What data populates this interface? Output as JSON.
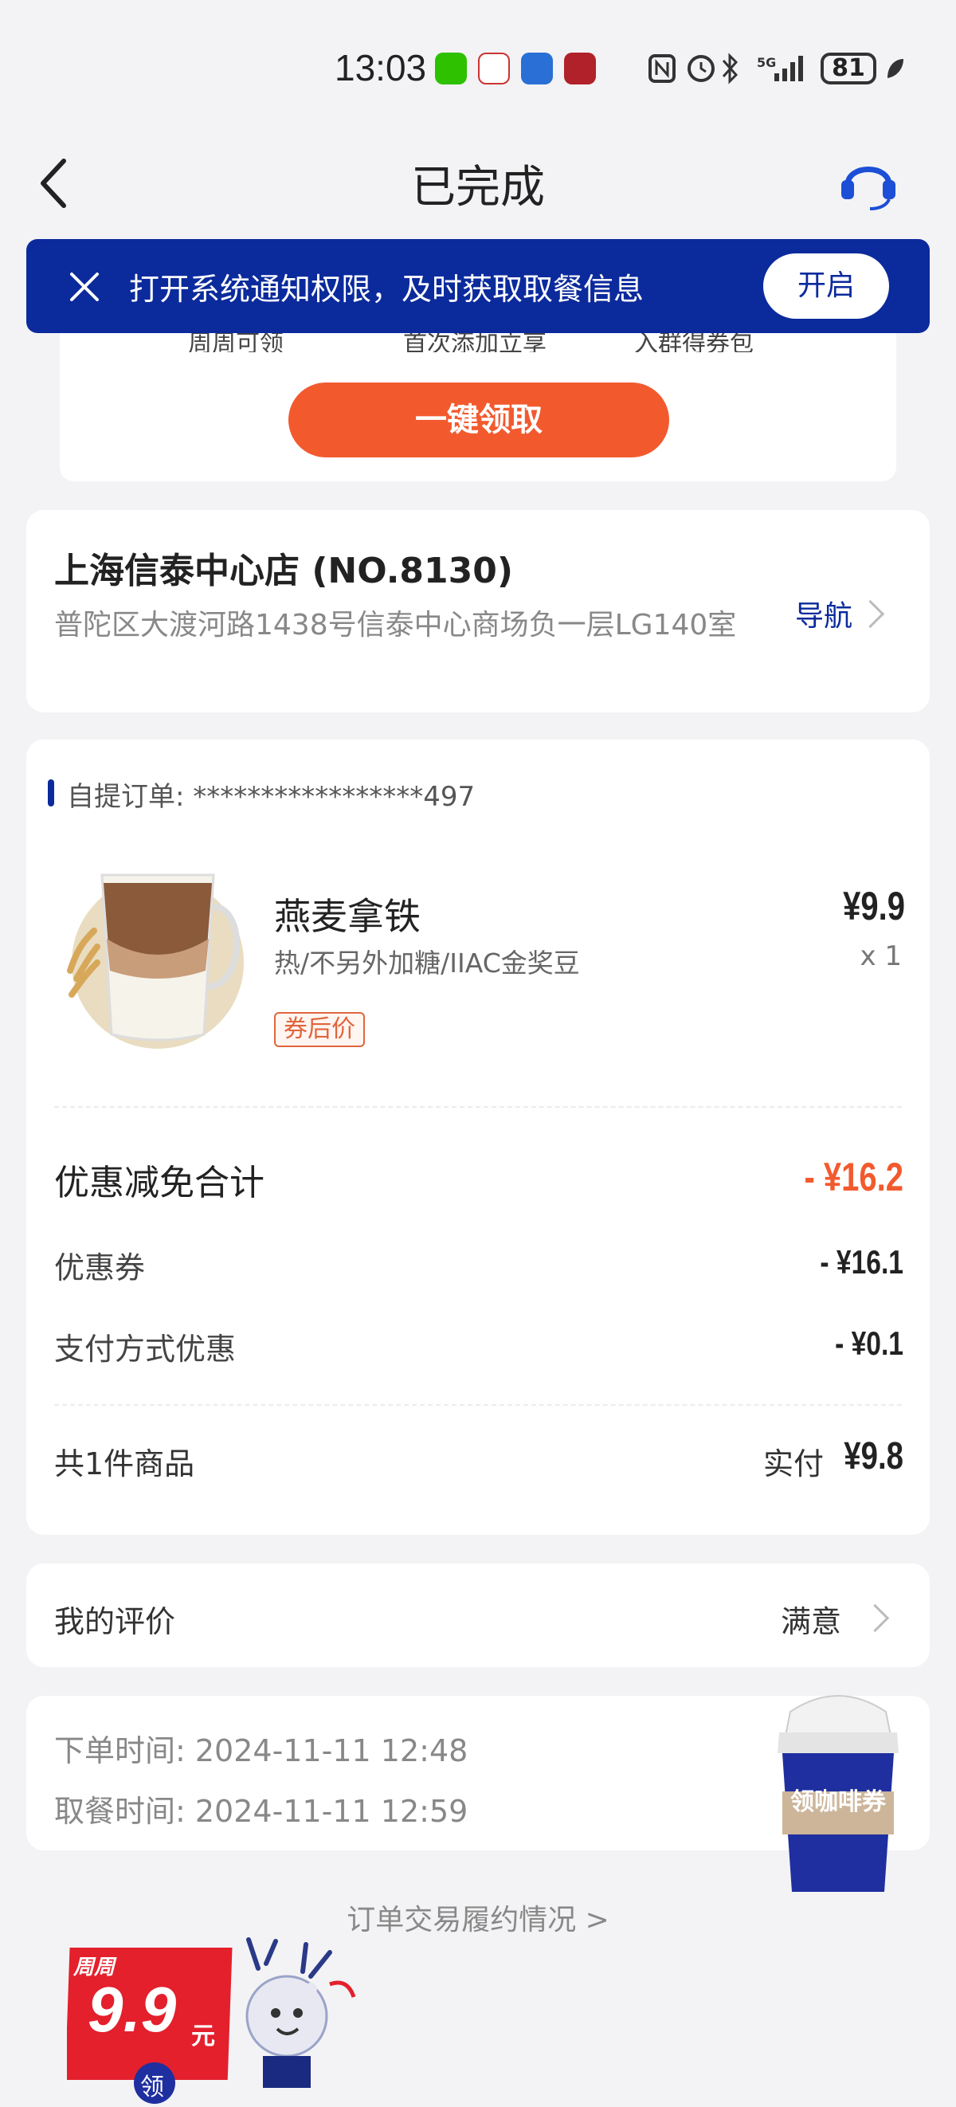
{
  "status_bar": {
    "time": "13:03",
    "battery": "81",
    "network": "5G"
  },
  "header": {
    "title": "已完成"
  },
  "notify_banner": {
    "text": "打开系统通知权限，及时获取取餐信息",
    "button": "开启"
  },
  "promo": {
    "subtitles": [
      "周周可领",
      "首次添加立享",
      "入群得券包"
    ],
    "button": "一键领取"
  },
  "store": {
    "name": "上海信泰中心店 (NO.8130)",
    "address": "普陀区大渡河路1438号信泰中心商场负一层LG140室",
    "nav_label": "导航"
  },
  "order": {
    "label": "自提订单: *****************497",
    "item": {
      "name": "燕麦拿铁",
      "spec": "热/不另外加糖/IIAC金奖豆",
      "tag": "券后价",
      "price": "¥9.9",
      "qty": "x 1"
    },
    "discount_total_label": "优惠减免合计",
    "discount_total_value": "- ¥16.2",
    "coupon_label": "优惠券",
    "coupon_value": "- ¥16.1",
    "pay_discount_label": "支付方式优惠",
    "pay_discount_value": "- ¥0.1",
    "count_label": "共1件商品",
    "paid_label": "实付",
    "paid_value": "¥9.8"
  },
  "review": {
    "label": "我的评价",
    "value": "满意"
  },
  "times": {
    "order_time": "下单时间:  2024-11-11 12:48",
    "pickup_time": "取餐时间:  2024-11-11 12:59"
  },
  "cup_promo": {
    "text": "领咖啡券"
  },
  "trade_link": "订单交易履约情况 >",
  "weekly_badge": {
    "top": "周周",
    "price": "9.9",
    "unit": "元",
    "get": "领"
  },
  "colors": {
    "brand_blue": "#0b2a9c",
    "accent_orange": "#f25a2e"
  }
}
